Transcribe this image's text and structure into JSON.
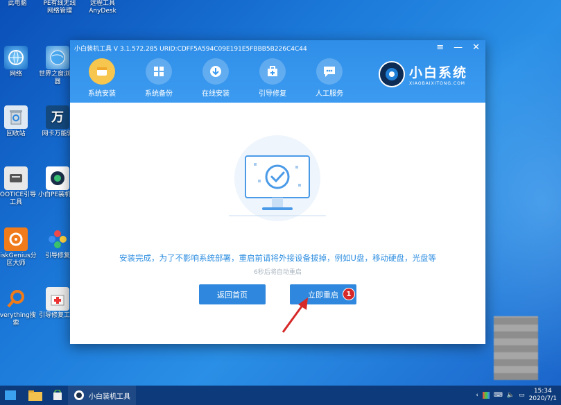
{
  "desktop": {
    "top_labels": [
      "此电脑",
      "PE有线无线网络管理",
      "远程工具 AnyDesk"
    ],
    "icons": [
      {
        "label": "网络",
        "icon": "network-icon"
      },
      {
        "label": "世界之窗浏览器",
        "icon": "globe-browser-icon"
      },
      {
        "label": "回收站",
        "icon": "recycle-bin-icon"
      },
      {
        "label": "网卡万能驱",
        "icon": "driver-icon"
      },
      {
        "label": "BOOTICE引导工具",
        "icon": "bootice-icon"
      },
      {
        "label": "小白PE装机具",
        "icon": "xiaobai-pe-icon"
      },
      {
        "label": "DiskGenius分区大师",
        "icon": "diskgenius-icon"
      },
      {
        "label": "引导修复",
        "icon": "boot-repair-icon"
      },
      {
        "label": "Everything搜索",
        "icon": "everything-search-icon"
      },
      {
        "label": "引导修复工具",
        "icon": "boot-repair-tool-icon"
      }
    ]
  },
  "window": {
    "title": "小白装机工具 V 3.1.572.285 URID:CDFF5A594C09E191E5FBBB5B226C4C44",
    "controls": {
      "menu": "≡",
      "minimize": "—",
      "close": "✕"
    },
    "nav": [
      {
        "label": "系统安装",
        "icon": "system-install-icon",
        "active": true
      },
      {
        "label": "系统备份",
        "icon": "system-backup-icon",
        "active": false
      },
      {
        "label": "在线安装",
        "icon": "online-install-icon",
        "active": false
      },
      {
        "label": "引导修复",
        "icon": "boot-repair-icon",
        "active": false
      },
      {
        "label": "人工服务",
        "icon": "chat-service-icon",
        "active": false
      }
    ],
    "brand": {
      "name": "小白系统",
      "url": "XIAOBAIXITONG.COM"
    },
    "message": "安装完成，为了不影响系统部署，重启前请将外接设备拔掉，例如U盘，移动硬盘，光盘等",
    "countdown": "6秒后将自动重启",
    "back_button": "返回首页",
    "restart_button": "立即重启",
    "badge": "1"
  },
  "taskbar": {
    "app_label": "小白装机工具",
    "time": "15:34",
    "date": "2020/7/1"
  },
  "colors": {
    "accent": "#2f88de",
    "header": "#3c9bf0",
    "message": "#2d8ee0",
    "badge": "#d62828",
    "active_nav": "#f6c64e"
  }
}
